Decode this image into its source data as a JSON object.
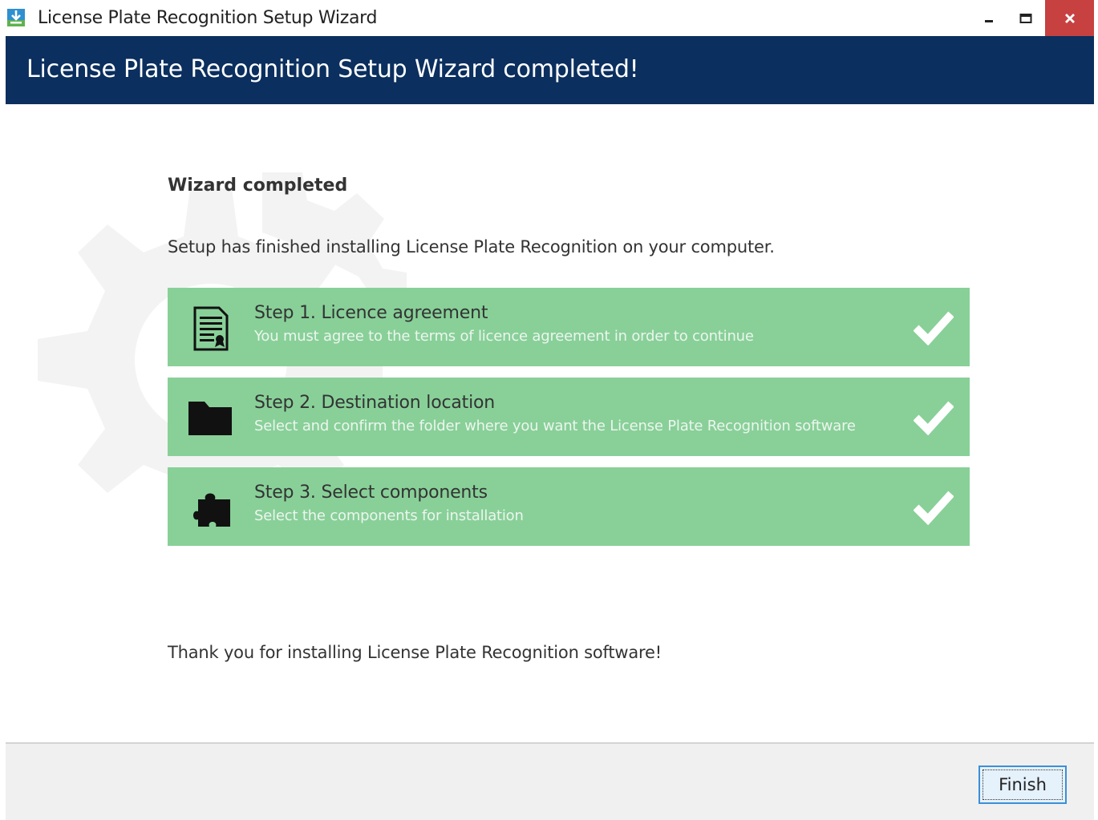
{
  "window": {
    "title": "License Plate Recognition Setup Wizard",
    "icon": "installer-icon",
    "controls": {
      "minimize": "minimize-icon",
      "maximize": "maximize-icon",
      "close": "close-icon"
    }
  },
  "header": {
    "title": "License Plate Recognition Setup Wizard completed!"
  },
  "main": {
    "heading": "Wizard completed",
    "intro": "Setup has finished installing  License Plate Recognition on your computer.",
    "steps": [
      {
        "title": "Step 1. Licence agreement",
        "description": "You must agree to the terms of licence agreement in order to continue",
        "icon": "document-icon",
        "status": "completed"
      },
      {
        "title": "Step 2. Destination location",
        "description": "Select and confirm the folder where you want the License Plate Recognition software",
        "icon": "folder-icon",
        "status": "completed"
      },
      {
        "title": "Step 3. Select components",
        "description": "Select the components for installation",
        "icon": "puzzle-icon",
        "status": "completed"
      }
    ],
    "thanks": "Thank you for installing  License Plate Recognition software!"
  },
  "footer": {
    "finish_label": "Finish"
  },
  "colors": {
    "header_bg": "#0b2f5e",
    "step_bg": "#88d098",
    "close_bg": "#c74141",
    "footer_bg": "#f0f0f0"
  }
}
